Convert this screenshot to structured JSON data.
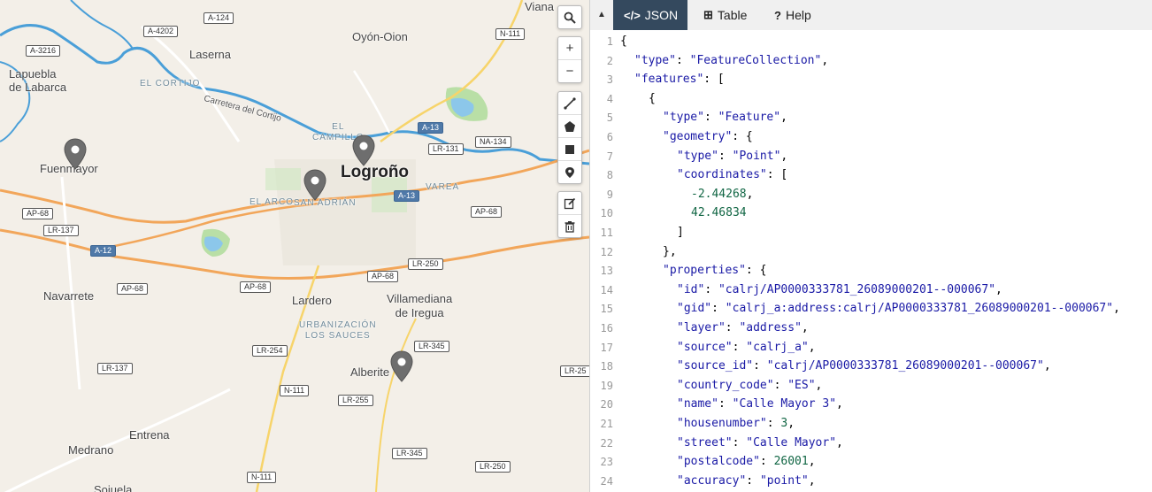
{
  "map": {
    "places": [
      {
        "id": "viana",
        "text": "Viana"
      },
      {
        "id": "oyon",
        "text": "Oyón-Oion"
      },
      {
        "id": "laserna",
        "text": "Laserna"
      },
      {
        "id": "lapuebla",
        "text": "Lapuebla\nde Labarca"
      },
      {
        "id": "cortijo",
        "text": "EL CORTIJO"
      },
      {
        "id": "carretera",
        "text": "Carretera del Cortijo"
      },
      {
        "id": "campillo",
        "text": "EL\nCAMPILLO"
      },
      {
        "id": "logrono",
        "text": "Logroño"
      },
      {
        "id": "fuenmayor",
        "text": "Fuenmayor"
      },
      {
        "id": "varea",
        "text": "VAREA"
      },
      {
        "id": "elarco",
        "text": "EL ARCO"
      },
      {
        "id": "sanadrian",
        "text": "SAN ADRIÁN"
      },
      {
        "id": "navarrete",
        "text": "Navarrete"
      },
      {
        "id": "lardero",
        "text": "Lardero"
      },
      {
        "id": "villamediana",
        "text": "Villamediana\nde Iregua"
      },
      {
        "id": "urbanizacion",
        "text": "URBANIZACIÓN\nLOS SAUCES"
      },
      {
        "id": "alberite",
        "text": "Alberite"
      },
      {
        "id": "entrena",
        "text": "Entrena"
      },
      {
        "id": "medrano",
        "text": "Medrano"
      },
      {
        "id": "sojuela",
        "text": "Sojuela"
      }
    ],
    "shields": [
      {
        "id": "a124",
        "text": "A-124",
        "type": "regional"
      },
      {
        "id": "a4202",
        "text": "A-4202",
        "type": "regional"
      },
      {
        "id": "a3216",
        "text": "A-3216",
        "type": "regional"
      },
      {
        "id": "n111a",
        "text": "N-111",
        "type": "regional"
      },
      {
        "id": "a13a",
        "text": "A-13",
        "type": "motorway"
      },
      {
        "id": "lr131",
        "text": "LR-131",
        "type": "regional"
      },
      {
        "id": "na134",
        "text": "NA-134",
        "type": "regional"
      },
      {
        "id": "a13b",
        "text": "A-13",
        "type": "motorway"
      },
      {
        "id": "ap68a",
        "text": "AP-68",
        "type": "regional"
      },
      {
        "id": "ap68b",
        "text": "AP-68",
        "type": "regional"
      },
      {
        "id": "lr137a",
        "text": "LR-137",
        "type": "regional"
      },
      {
        "id": "a12",
        "text": "A-12",
        "type": "motorway"
      },
      {
        "id": "ap68c",
        "text": "AP-68",
        "type": "regional"
      },
      {
        "id": "ap68d",
        "text": "AP-68",
        "type": "regional"
      },
      {
        "id": "ap68e",
        "text": "AP-68",
        "type": "regional"
      },
      {
        "id": "lr250a",
        "text": "LR-250",
        "type": "regional"
      },
      {
        "id": "lr345a",
        "text": "LR-345",
        "type": "regional"
      },
      {
        "id": "lr254",
        "text": "LR-254",
        "type": "regional"
      },
      {
        "id": "lr25",
        "text": "LR-25",
        "type": "regional"
      },
      {
        "id": "lr137b",
        "text": "LR-137",
        "type": "regional"
      },
      {
        "id": "n111b",
        "text": "N-111",
        "type": "regional"
      },
      {
        "id": "lr255",
        "text": "LR-255",
        "type": "regional"
      },
      {
        "id": "lr345b",
        "text": "LR-345",
        "type": "regional"
      },
      {
        "id": "lr250b",
        "text": "LR-250",
        "type": "regional"
      },
      {
        "id": "n111c",
        "text": "N-111",
        "type": "regional"
      }
    ],
    "toolbar": {
      "search": "search-icon",
      "zoom_in": "+",
      "zoom_out": "−",
      "draw": [
        "draw-line-icon",
        "draw-polygon-icon",
        "draw-rectangle-icon",
        "draw-marker-icon"
      ],
      "edit": [
        "edit-icon",
        "trash-icon"
      ]
    }
  },
  "panel": {
    "tabs": [
      {
        "id": "json",
        "icon": "</>",
        "label": "JSON",
        "active": true
      },
      {
        "id": "table",
        "icon": "⊞",
        "label": "Table",
        "active": false
      },
      {
        "id": "help",
        "icon": "?",
        "label": "Help",
        "active": false
      }
    ],
    "collapse_icon": "▲",
    "lines": [
      {
        "n": "1",
        "indent": 0,
        "tokens": [
          {
            "t": "p",
            "v": "{"
          }
        ]
      },
      {
        "n": "2",
        "indent": 1,
        "tokens": [
          {
            "t": "k",
            "v": "\"type\""
          },
          {
            "t": "p",
            "v": ": "
          },
          {
            "t": "s",
            "v": "\"FeatureCollection\""
          },
          {
            "t": "p",
            "v": ","
          }
        ]
      },
      {
        "n": "3",
        "indent": 1,
        "tokens": [
          {
            "t": "k",
            "v": "\"features\""
          },
          {
            "t": "p",
            "v": ": ["
          }
        ]
      },
      {
        "n": "4",
        "indent": 2,
        "tokens": [
          {
            "t": "p",
            "v": "{"
          }
        ]
      },
      {
        "n": "5",
        "indent": 3,
        "tokens": [
          {
            "t": "k",
            "v": "\"type\""
          },
          {
            "t": "p",
            "v": ": "
          },
          {
            "t": "s",
            "v": "\"Feature\""
          },
          {
            "t": "p",
            "v": ","
          }
        ]
      },
      {
        "n": "6",
        "indent": 3,
        "tokens": [
          {
            "t": "k",
            "v": "\"geometry\""
          },
          {
            "t": "p",
            "v": ": {"
          }
        ]
      },
      {
        "n": "7",
        "indent": 4,
        "tokens": [
          {
            "t": "k",
            "v": "\"type\""
          },
          {
            "t": "p",
            "v": ": "
          },
          {
            "t": "s",
            "v": "\"Point\""
          },
          {
            "t": "p",
            "v": ","
          }
        ]
      },
      {
        "n": "8",
        "indent": 4,
        "tokens": [
          {
            "t": "k",
            "v": "\"coordinates\""
          },
          {
            "t": "p",
            "v": ": ["
          }
        ]
      },
      {
        "n": "9",
        "indent": 5,
        "tokens": [
          {
            "t": "n",
            "v": "-2.44268"
          },
          {
            "t": "p",
            "v": ","
          }
        ]
      },
      {
        "n": "10",
        "indent": 5,
        "tokens": [
          {
            "t": "n",
            "v": "42.46834"
          }
        ]
      },
      {
        "n": "11",
        "indent": 4,
        "tokens": [
          {
            "t": "p",
            "v": "]"
          }
        ]
      },
      {
        "n": "12",
        "indent": 3,
        "tokens": [
          {
            "t": "p",
            "v": "},"
          }
        ]
      },
      {
        "n": "13",
        "indent": 3,
        "tokens": [
          {
            "t": "k",
            "v": "\"properties\""
          },
          {
            "t": "p",
            "v": ": {"
          }
        ]
      },
      {
        "n": "14",
        "indent": 4,
        "tokens": [
          {
            "t": "k",
            "v": "\"id\""
          },
          {
            "t": "p",
            "v": ": "
          },
          {
            "t": "s",
            "v": "\"calrj/AP0000333781_26089000201--000067\""
          },
          {
            "t": "p",
            "v": ","
          }
        ]
      },
      {
        "n": "15",
        "indent": 4,
        "tokens": [
          {
            "t": "k",
            "v": "\"gid\""
          },
          {
            "t": "p",
            "v": ": "
          },
          {
            "t": "s",
            "v": "\"calrj_a:address:calrj/AP0000333781_26089000201--000067\""
          },
          {
            "t": "p",
            "v": ","
          }
        ]
      },
      {
        "n": "16",
        "indent": 4,
        "tokens": [
          {
            "t": "k",
            "v": "\"layer\""
          },
          {
            "t": "p",
            "v": ": "
          },
          {
            "t": "s",
            "v": "\"address\""
          },
          {
            "t": "p",
            "v": ","
          }
        ]
      },
      {
        "n": "17",
        "indent": 4,
        "tokens": [
          {
            "t": "k",
            "v": "\"source\""
          },
          {
            "t": "p",
            "v": ": "
          },
          {
            "t": "s",
            "v": "\"calrj_a\""
          },
          {
            "t": "p",
            "v": ","
          }
        ]
      },
      {
        "n": "18",
        "indent": 4,
        "tokens": [
          {
            "t": "k",
            "v": "\"source_id\""
          },
          {
            "t": "p",
            "v": ": "
          },
          {
            "t": "s",
            "v": "\"calrj/AP0000333781_26089000201--000067\""
          },
          {
            "t": "p",
            "v": ","
          }
        ]
      },
      {
        "n": "19",
        "indent": 4,
        "tokens": [
          {
            "t": "k",
            "v": "\"country_code\""
          },
          {
            "t": "p",
            "v": ": "
          },
          {
            "t": "s",
            "v": "\"ES\""
          },
          {
            "t": "p",
            "v": ","
          }
        ]
      },
      {
        "n": "20",
        "indent": 4,
        "tokens": [
          {
            "t": "k",
            "v": "\"name\""
          },
          {
            "t": "p",
            "v": ": "
          },
          {
            "t": "s",
            "v": "\"Calle Mayor 3\""
          },
          {
            "t": "p",
            "v": ","
          }
        ]
      },
      {
        "n": "21",
        "indent": 4,
        "tokens": [
          {
            "t": "k",
            "v": "\"housenumber\""
          },
          {
            "t": "p",
            "v": ": "
          },
          {
            "t": "n",
            "v": "3"
          },
          {
            "t": "p",
            "v": ","
          }
        ]
      },
      {
        "n": "22",
        "indent": 4,
        "tokens": [
          {
            "t": "k",
            "v": "\"street\""
          },
          {
            "t": "p",
            "v": ": "
          },
          {
            "t": "s",
            "v": "\"Calle Mayor\""
          },
          {
            "t": "p",
            "v": ","
          }
        ]
      },
      {
        "n": "23",
        "indent": 4,
        "tokens": [
          {
            "t": "k",
            "v": "\"postalcode\""
          },
          {
            "t": "p",
            "v": ": "
          },
          {
            "t": "n",
            "v": "26001"
          },
          {
            "t": "p",
            "v": ","
          }
        ]
      },
      {
        "n": "24",
        "indent": 4,
        "tokens": [
          {
            "t": "k",
            "v": "\"accuracy\""
          },
          {
            "t": "p",
            "v": ": "
          },
          {
            "t": "s",
            "v": "\"point\""
          },
          {
            "t": "p",
            "v": ","
          }
        ]
      }
    ]
  },
  "colors": {
    "tab_active_bg": "#34495e",
    "json_key": "#1a1aa6",
    "json_number": "#116644",
    "motorway": "#4f79a8",
    "river": "#4a9fd8",
    "primary_road": "#f2a65a",
    "secondary_road": "#f7d46a",
    "pin": "#666666"
  }
}
